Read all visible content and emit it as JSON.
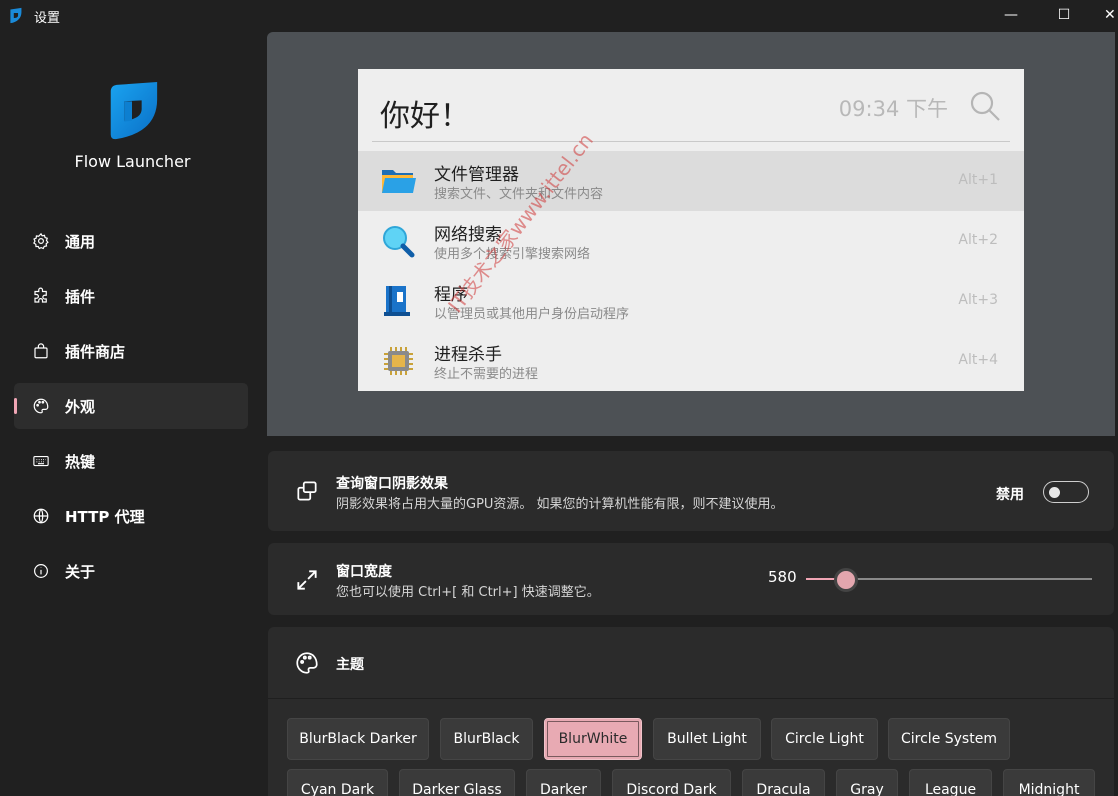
{
  "window": {
    "title": "设置",
    "app_icon": "flow-launcher-icon",
    "controls": {
      "minimize": "—",
      "maximize": "☐",
      "close": "✕"
    }
  },
  "sidebar": {
    "app_name": "Flow Launcher",
    "items": [
      {
        "label": "通用",
        "icon": "gear-icon",
        "active": false
      },
      {
        "label": "插件",
        "icon": "puzzle-icon",
        "active": false
      },
      {
        "label": "插件商店",
        "icon": "shopping-bag-icon",
        "active": false
      },
      {
        "label": "外观",
        "icon": "palette-icon",
        "active": true
      },
      {
        "label": "热键",
        "icon": "keyboard-icon",
        "active": false
      },
      {
        "label": "HTTP 代理",
        "icon": "globe-icon",
        "active": false
      },
      {
        "label": "关于",
        "icon": "info-icon",
        "active": false
      }
    ]
  },
  "preview": {
    "query": "你好！",
    "clock": "09:34 下午",
    "results": [
      {
        "title": "文件管理器",
        "subtitle": "搜索文件、文件夹和文件内容",
        "hotkey": "Alt+1",
        "icon": "folder-icon",
        "selected": true
      },
      {
        "title": "网络搜索",
        "subtitle": "使用多个搜索引擎搜索网络",
        "hotkey": "Alt+2",
        "icon": "magnifier-icon",
        "selected": false
      },
      {
        "title": "程序",
        "subtitle": "以管理员或其他用户身份启动程序",
        "hotkey": "Alt+3",
        "icon": "program-icon",
        "selected": false
      },
      {
        "title": "进程杀手",
        "subtitle": "终止不需要的进程",
        "hotkey": "Alt+4",
        "icon": "cpu-chip-icon",
        "selected": false
      }
    ]
  },
  "shadow_setting": {
    "title": "查询窗口阴影效果",
    "description": "阴影效果将占用大量的GPU资源。 如果您的计算机性能有限，则不建议使用。",
    "toggle_label": "禁用",
    "enabled": false
  },
  "width_setting": {
    "title": "窗口宽度",
    "description": "您也可以使用 Ctrl+[ 和 Ctrl+] 快速调整它。",
    "value": "580",
    "slider_fraction": 0.14
  },
  "theme_section": {
    "title": "主题",
    "selected": "BlurWhite",
    "themes_row1": [
      "BlurBlack Darker",
      "BlurBlack",
      "BlurWhite",
      "Bullet Light",
      "Circle Light",
      "Circle System"
    ],
    "themes_row2": [
      "Cyan Dark",
      "Darker Glass",
      "Darker",
      "Discord Dark",
      "Dracula",
      "Gray",
      "League",
      "Midnight"
    ]
  },
  "watermark": "IT技术之家www.ittel.cn",
  "colors": {
    "accent": "#f0a5b4",
    "background": "#202020",
    "card": "#2b2b2b",
    "preview_bg": "#4d5155"
  }
}
